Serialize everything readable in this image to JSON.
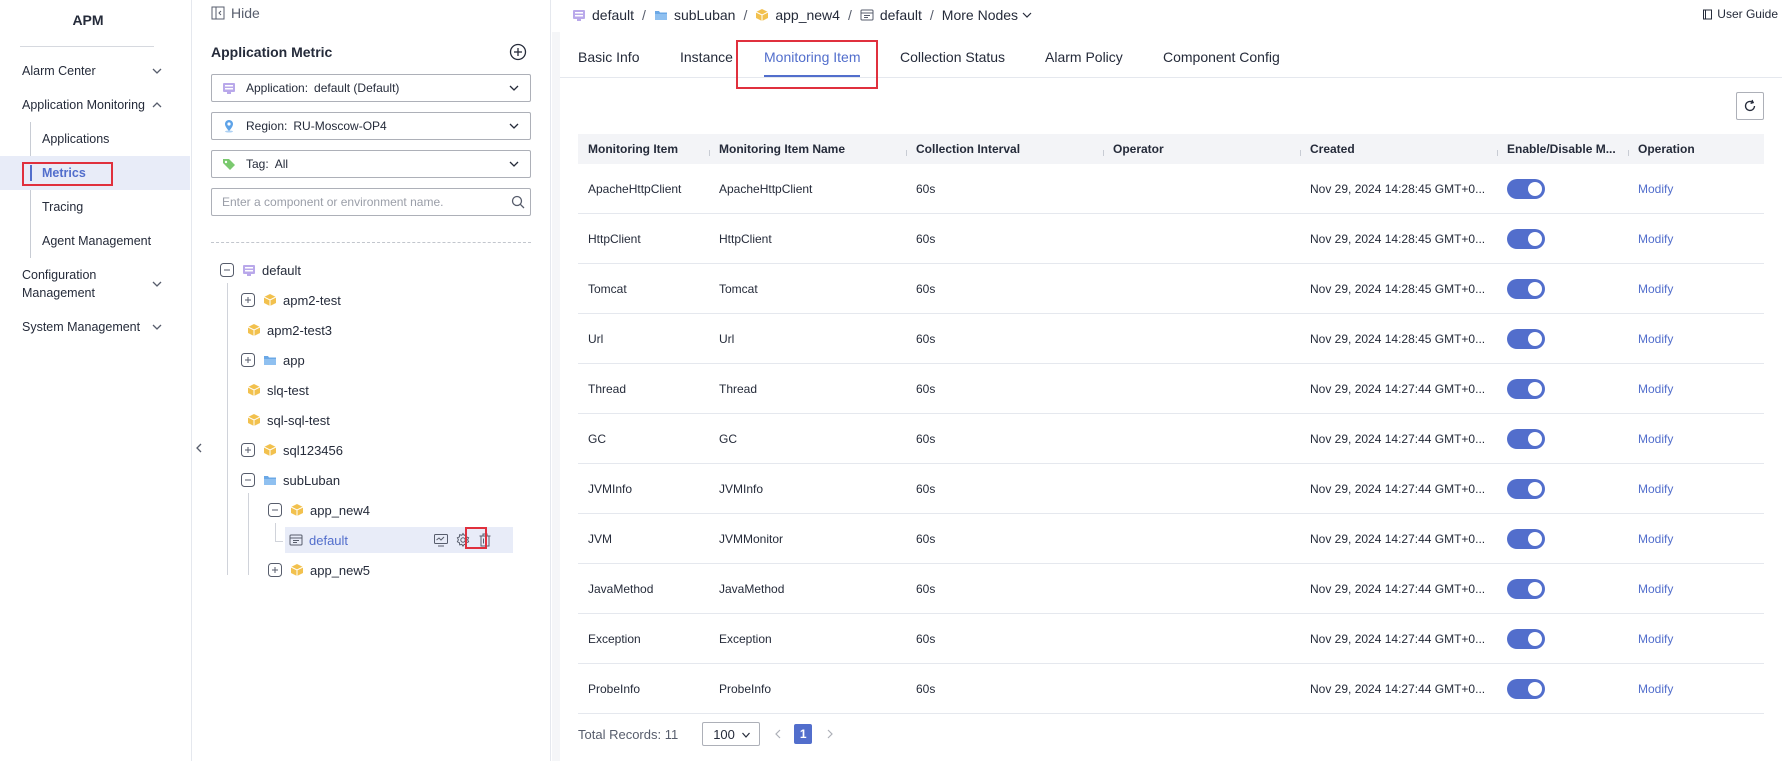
{
  "app_title": "APM",
  "nav": {
    "alarm_center": "Alarm Center",
    "application_monitoring": "Application Monitoring",
    "applications": "Applications",
    "metrics": "Metrics",
    "tracing": "Tracing",
    "agent_management": "Agent Management",
    "configuration_management": "Configuration Management",
    "system_management": "System Management"
  },
  "panel": {
    "hide_label": "Hide",
    "title": "Application Metric",
    "application_label": "Application:",
    "application_value": "default (Default)",
    "region_label": "Region:",
    "region_value": "RU-Moscow-OP4",
    "tag_label": "Tag:",
    "tag_value": "All",
    "search_placeholder": "Enter a component or environment name."
  },
  "tree": {
    "root": "default",
    "apm2_test": "apm2-test",
    "apm2_test3": "apm2-test3",
    "app": "app",
    "slq_test": "slq-test",
    "sql_sql_test": "sql-sql-test",
    "sql123456": "sql123456",
    "subluban": "subLuban",
    "app_new4": "app_new4",
    "env_default": "default",
    "app_new5": "app_new5"
  },
  "breadcrumb": {
    "items": [
      "default",
      "subLuban",
      "app_new4",
      "default"
    ],
    "more_nodes": "More Nodes",
    "user_guide": "User Guide"
  },
  "tabs": [
    "Basic Info",
    "Instance",
    "Monitoring Item",
    "Collection Status",
    "Alarm Policy",
    "Component Config"
  ],
  "table": {
    "headers": [
      "Monitoring Item",
      "Monitoring Item Name",
      "Collection Interval",
      "Operator",
      "Created",
      "Enable/Disable M...",
      "Operation"
    ],
    "rows": [
      {
        "item": "ApacheHttpClient",
        "name": "ApacheHttpClient",
        "interval": "60s",
        "operator": "",
        "created": "Nov 29, 2024 14:28:45 GMT+0...",
        "enabled": true,
        "op": "Modify"
      },
      {
        "item": "HttpClient",
        "name": "HttpClient",
        "interval": "60s",
        "operator": "",
        "created": "Nov 29, 2024 14:28:45 GMT+0...",
        "enabled": true,
        "op": "Modify"
      },
      {
        "item": "Tomcat",
        "name": "Tomcat",
        "interval": "60s",
        "operator": "",
        "created": "Nov 29, 2024 14:28:45 GMT+0...",
        "enabled": true,
        "op": "Modify"
      },
      {
        "item": "Url",
        "name": "Url",
        "interval": "60s",
        "operator": "",
        "created": "Nov 29, 2024 14:28:45 GMT+0...",
        "enabled": true,
        "op": "Modify"
      },
      {
        "item": "Thread",
        "name": "Thread",
        "interval": "60s",
        "operator": "",
        "created": "Nov 29, 2024 14:27:44 GMT+0...",
        "enabled": true,
        "op": "Modify"
      },
      {
        "item": "GC",
        "name": "GC",
        "interval": "60s",
        "operator": "",
        "created": "Nov 29, 2024 14:27:44 GMT+0...",
        "enabled": true,
        "op": "Modify"
      },
      {
        "item": "JVMInfo",
        "name": "JVMInfo",
        "interval": "60s",
        "operator": "",
        "created": "Nov 29, 2024 14:27:44 GMT+0...",
        "enabled": true,
        "op": "Modify"
      },
      {
        "item": "JVM",
        "name": "JVMMonitor",
        "interval": "60s",
        "operator": "",
        "created": "Nov 29, 2024 14:27:44 GMT+0...",
        "enabled": true,
        "op": "Modify"
      },
      {
        "item": "JavaMethod",
        "name": "JavaMethod",
        "interval": "60s",
        "operator": "",
        "created": "Nov 29, 2024 14:27:44 GMT+0...",
        "enabled": true,
        "op": "Modify"
      },
      {
        "item": "Exception",
        "name": "Exception",
        "interval": "60s",
        "operator": "",
        "created": "Nov 29, 2024 14:27:44 GMT+0...",
        "enabled": true,
        "op": "Modify"
      },
      {
        "item": "ProbeInfo",
        "name": "ProbeInfo",
        "interval": "60s",
        "operator": "",
        "created": "Nov 29, 2024 14:27:44 GMT+0...",
        "enabled": true,
        "op": "Modify"
      }
    ]
  },
  "footer": {
    "total": "Total Records: 11",
    "page_size": "100",
    "current_page": "1"
  },
  "colors": {
    "accent": "#526ecc",
    "highlight_box": "#e0303d",
    "folder_icon": "#6ba8e6",
    "component_icon": "#f2c14e"
  }
}
